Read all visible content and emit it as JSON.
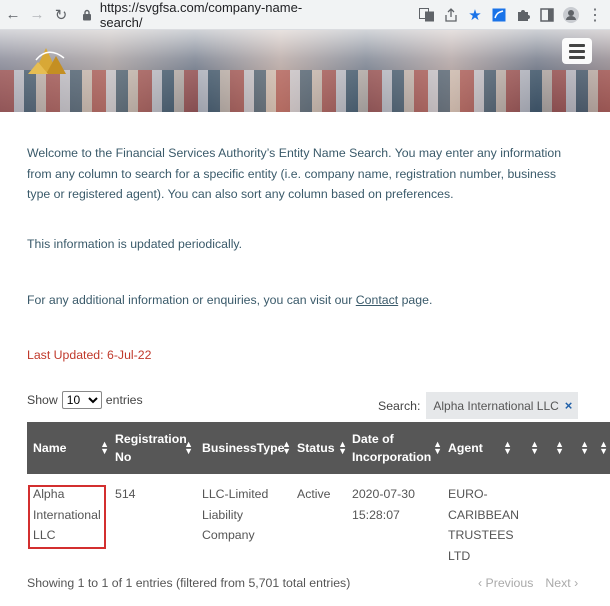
{
  "browser": {
    "url_scheme": "https://",
    "url_host_path": "svgfsa.com/company-name-search/"
  },
  "intro": {
    "welcome": "Welcome to the Financial Services Authority’s Entity Name Search. You may enter any information from any column to search for a specific entity (i.e. company name, registration number, business type or registered agent). You can also sort any column based on preferences.",
    "updated_note": "This information is updated periodically.",
    "contact_before": "For any additional information or enquiries, you can visit our ",
    "contact_link": "Contact",
    "contact_after": " page.",
    "last_updated": "Last Updated:  6-Jul-22"
  },
  "controls": {
    "show_label": "Show",
    "show_value": "10",
    "entries_label": "entries",
    "search_label": "Search:",
    "search_value": "Alpha International LLC",
    "clear_glyph": "×"
  },
  "table": {
    "headers": {
      "name": "Name",
      "registration_line1": "Registration",
      "registration_line2": "No",
      "business_type": "BusinessType",
      "status": "Status",
      "doi_line1": "Date of",
      "doi_line2": "Incorporation",
      "agent": "Agent"
    },
    "row": {
      "name_line1": "Alpha",
      "name_line2": "International",
      "name_line3": "LLC",
      "registration": "514",
      "type_line1": "LLC-Limited",
      "type_line2": "Liability",
      "type_line3": "Company",
      "status": "Active",
      "date_line1": "2020-07-30",
      "date_line2": "15:28:07",
      "agent_line1": "EURO-",
      "agent_line2": "CARIBBEAN",
      "agent_line3": "TRUSTEES",
      "agent_line4": "LTD"
    }
  },
  "footer": {
    "info": "Showing 1 to 1 of 1 entries (filtered from 5,701 total entries)",
    "previous": "Previous",
    "next": "Next"
  },
  "colors": {
    "header_bg": "#575757",
    "highlight": "#d32f2f",
    "last_updated": "#c0392b"
  }
}
